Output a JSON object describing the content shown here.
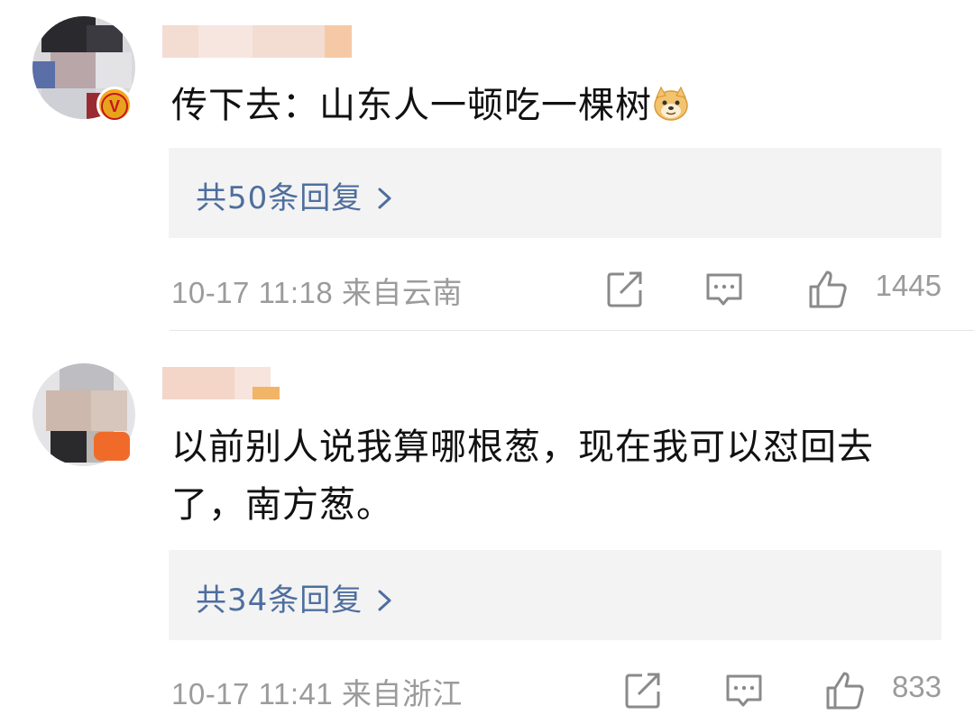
{
  "comments": [
    {
      "content": "传下去：山东人一顿吃一棵树",
      "emoji": "doge-emoji",
      "replies_label": "共50条回复",
      "time": "10-17 11:18",
      "location": "来自云南",
      "like_count": "1445",
      "verified_badge": "V"
    },
    {
      "content_line1": "以前别人说我算哪根葱，现在我可以怼回去",
      "content_line2": "了，南方葱。",
      "replies_label": "共34条回复",
      "time": "10-17 11:41",
      "location": "来自浙江",
      "like_count": "833"
    }
  ],
  "icons": {
    "forward": "share-icon",
    "comment": "comment-icon",
    "like": "thumbs-up-icon",
    "chevron": "chevron-right-icon"
  },
  "colors": {
    "link": "#4e6e9e",
    "meta_text": "#9b9b9b",
    "reply_bg": "#f3f3f3"
  }
}
